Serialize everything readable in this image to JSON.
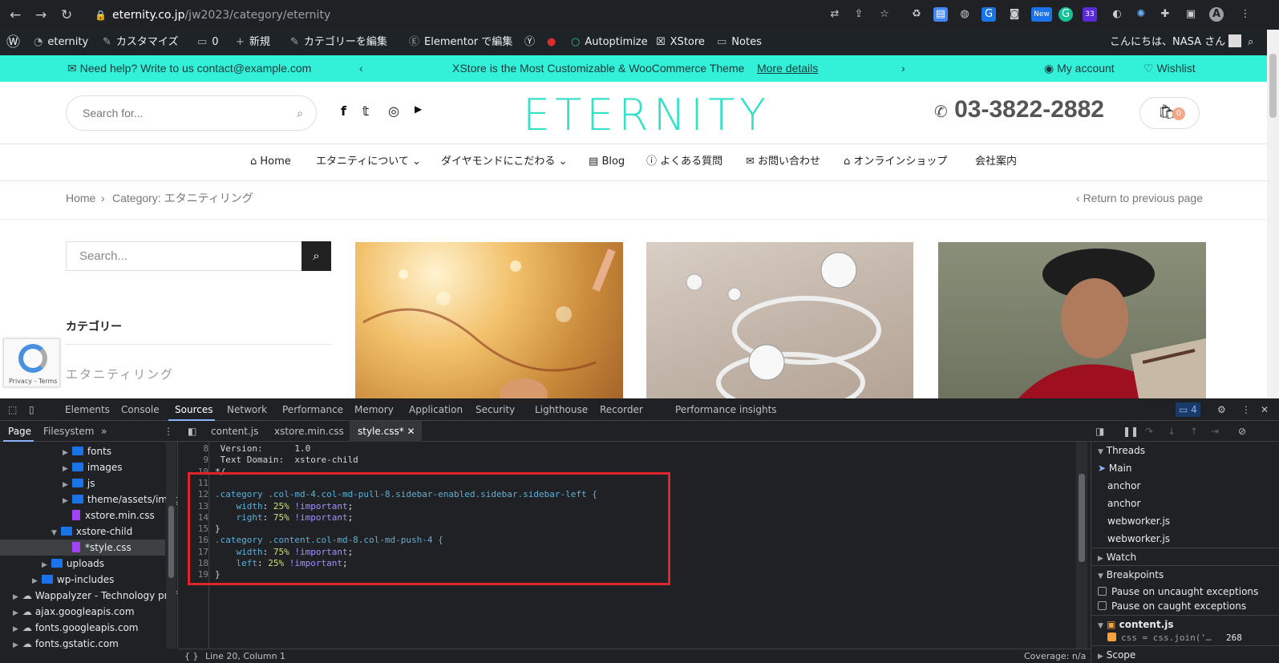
{
  "browser": {
    "url_host": "eternity.co.jp",
    "url_path": "/jw2023/category/eternity",
    "profile_initial": "A",
    "ext_badge": "33",
    "ext_new": "New"
  },
  "wp_bar": {
    "site": "eternity",
    "customize": "カスタマイズ",
    "comments": "0",
    "new": "新規",
    "edit_category": "カテゴリーを編集",
    "elementor": "Elementor で編集",
    "autoptimize": "Autoptimize",
    "xstore": "XStore",
    "notes": "Notes",
    "greeting": "こんにちは、NASA さん"
  },
  "promo": {
    "help": "Need help? Write to us contact@example.com",
    "center": "XStore is the Most Customizable & WooCommerce Theme",
    "more": "More details",
    "account": "My account",
    "wishlist": "Wishlist"
  },
  "header": {
    "search_placeholder": "Search for...",
    "logo": "ETERNITY",
    "phone": "03-3822-2882",
    "cart_count": "0"
  },
  "menu": {
    "items": [
      "Home",
      "エタニティについて",
      "ダイヤモンドにこだわる",
      "Blog",
      "よくある質問",
      "お問い合わせ",
      "オンラインショップ",
      "会社案内"
    ]
  },
  "breadcrumb": {
    "home": "Home",
    "current": "Category: エタニティリング",
    "back": "Return to previous page"
  },
  "sidebar": {
    "search_placeholder": "Search...",
    "categories_title": "カテゴリー",
    "category_item": "エタニティリング"
  },
  "recaptcha": {
    "text": "Privacy - Terms"
  },
  "devtools": {
    "tabs": [
      "Elements",
      "Console",
      "Sources",
      "Network",
      "Performance",
      "Memory",
      "Application",
      "Security",
      "Lighthouse",
      "Recorder",
      "Performance insights"
    ],
    "issues_count": "4",
    "nav_tabs": [
      "Page",
      "Filesystem"
    ],
    "file_tabs": [
      "content.js",
      "xstore.min.css",
      "style.css*"
    ],
    "tree": [
      "fonts",
      "images",
      "js",
      "theme/assets/imag",
      "xstore.min.css",
      "xstore-child",
      "*style.css",
      "uploads",
      "wp-includes",
      "Wappalyzer - Technology prof",
      "ajax.googleapis.com",
      "fonts.googleapis.com",
      "fonts.gstatic.com"
    ],
    "code_lines": [
      {
        "n": "8",
        "t": " Version:      1.0"
      },
      {
        "n": "9",
        "t": " Text Domain:  xstore-child"
      },
      {
        "n": "10",
        "t": "*/"
      },
      {
        "n": "11",
        "t": ""
      },
      {
        "n": "12",
        "t": ".category .col-md-4.col-md-pull-8.sidebar-enabled.sidebar.sidebar-left {"
      },
      {
        "n": "13",
        "t": "    width: 25% !important;"
      },
      {
        "n": "14",
        "t": "    right: 75% !important;"
      },
      {
        "n": "15",
        "t": "}"
      },
      {
        "n": "16",
        "t": ".category .content.col-md-8.col-md-push-4 {"
      },
      {
        "n": "17",
        "t": "    width: 75% !important;"
      },
      {
        "n": "18",
        "t": "    left: 25% !important;"
      },
      {
        "n": "19",
        "t": "}"
      }
    ],
    "status": "Line 20, Column 1",
    "coverage": "Coverage: n/a",
    "debugger": {
      "threads": "Threads",
      "main": "Main",
      "thread_items": [
        "anchor",
        "anchor",
        "webworker.js",
        "webworker.js"
      ],
      "watch": "Watch",
      "breakpoints": "Breakpoints",
      "pause_uncaught": "Pause on uncaught exceptions",
      "pause_caught": "Pause on caught exceptions",
      "bp_file": "content.js",
      "bp_code": "css = css.join('…",
      "bp_line": "268",
      "scope": "Scope"
    }
  },
  "colors": {
    "accent": "#33f0d8",
    "logo": "#33e0c8",
    "highlight_box": "#e1242b"
  }
}
